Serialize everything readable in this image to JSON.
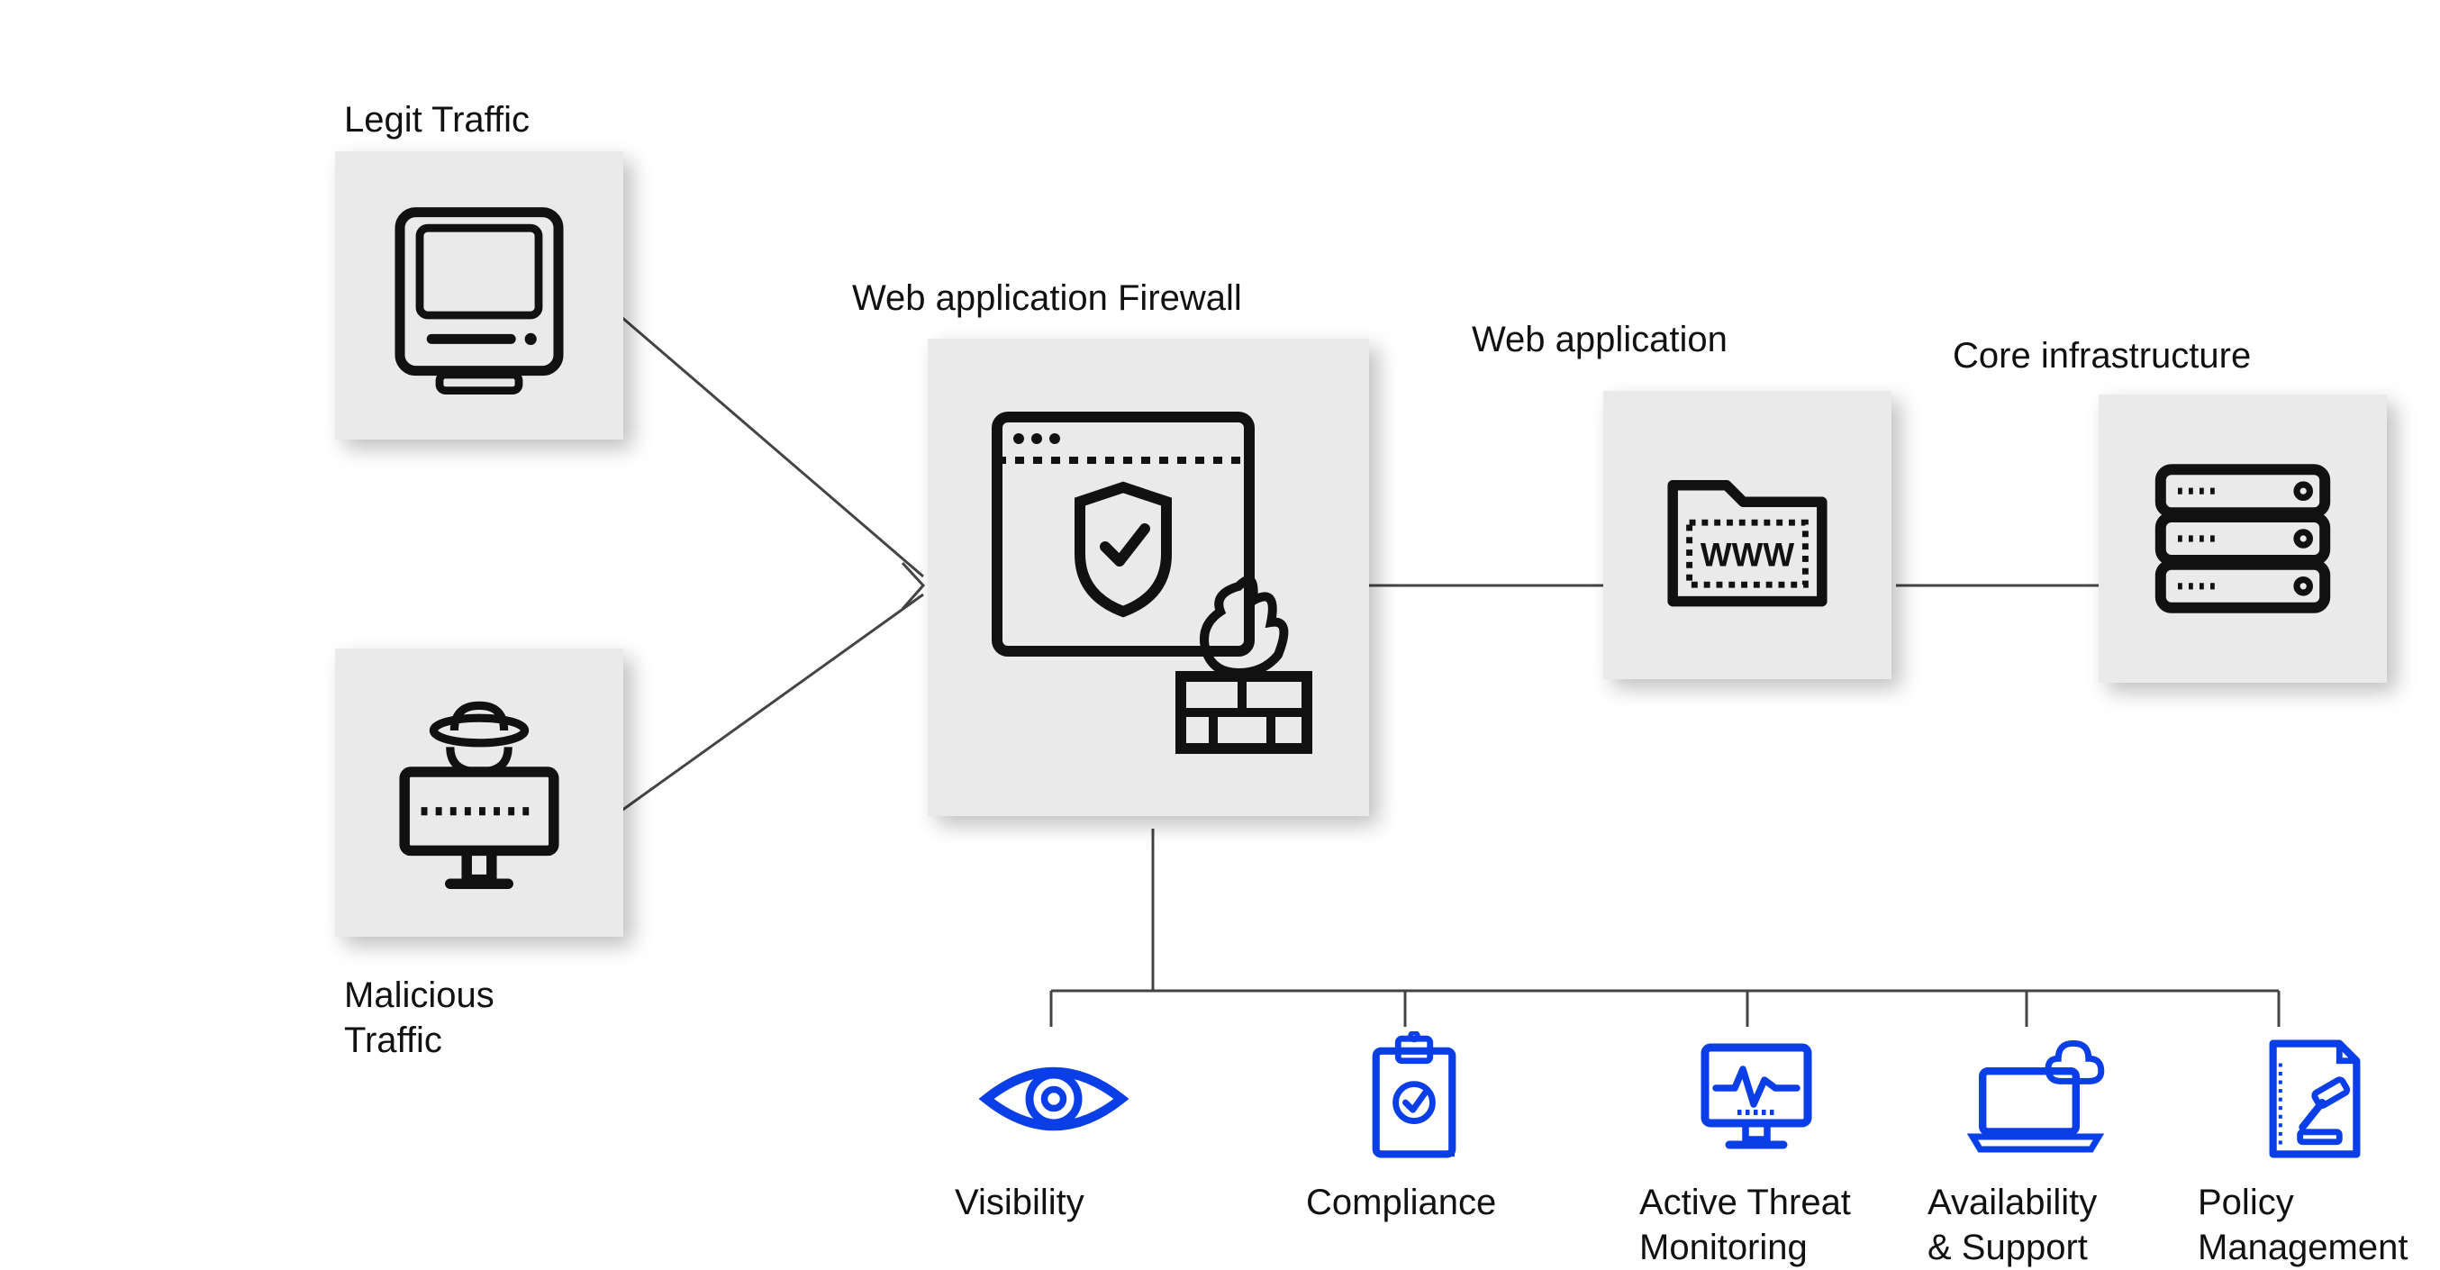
{
  "nodes": {
    "legit": {
      "label": "Legit Traffic"
    },
    "malicious": {
      "label": "Malicious\nTraffic"
    },
    "waf": {
      "label": "Web application Firewall"
    },
    "webapp": {
      "label": "Web application",
      "icon_text": "WWW"
    },
    "core": {
      "label": "Core infrastructure"
    }
  },
  "features": [
    {
      "label": "Visibility",
      "icon": "eye"
    },
    {
      "label": "Compliance",
      "icon": "clipboard"
    },
    {
      "label": "Active Threat\nMonitoring",
      "icon": "monitor"
    },
    {
      "label": "Availability\n& Support",
      "icon": "laptop-cloud"
    },
    {
      "label": "Policy\nManagement",
      "icon": "gavel-doc"
    }
  ],
  "colors": {
    "box_bg": "#eaeaea",
    "icon_stroke": "#111111",
    "feature_blue": "#0a3ee6",
    "connector": "#444444"
  }
}
